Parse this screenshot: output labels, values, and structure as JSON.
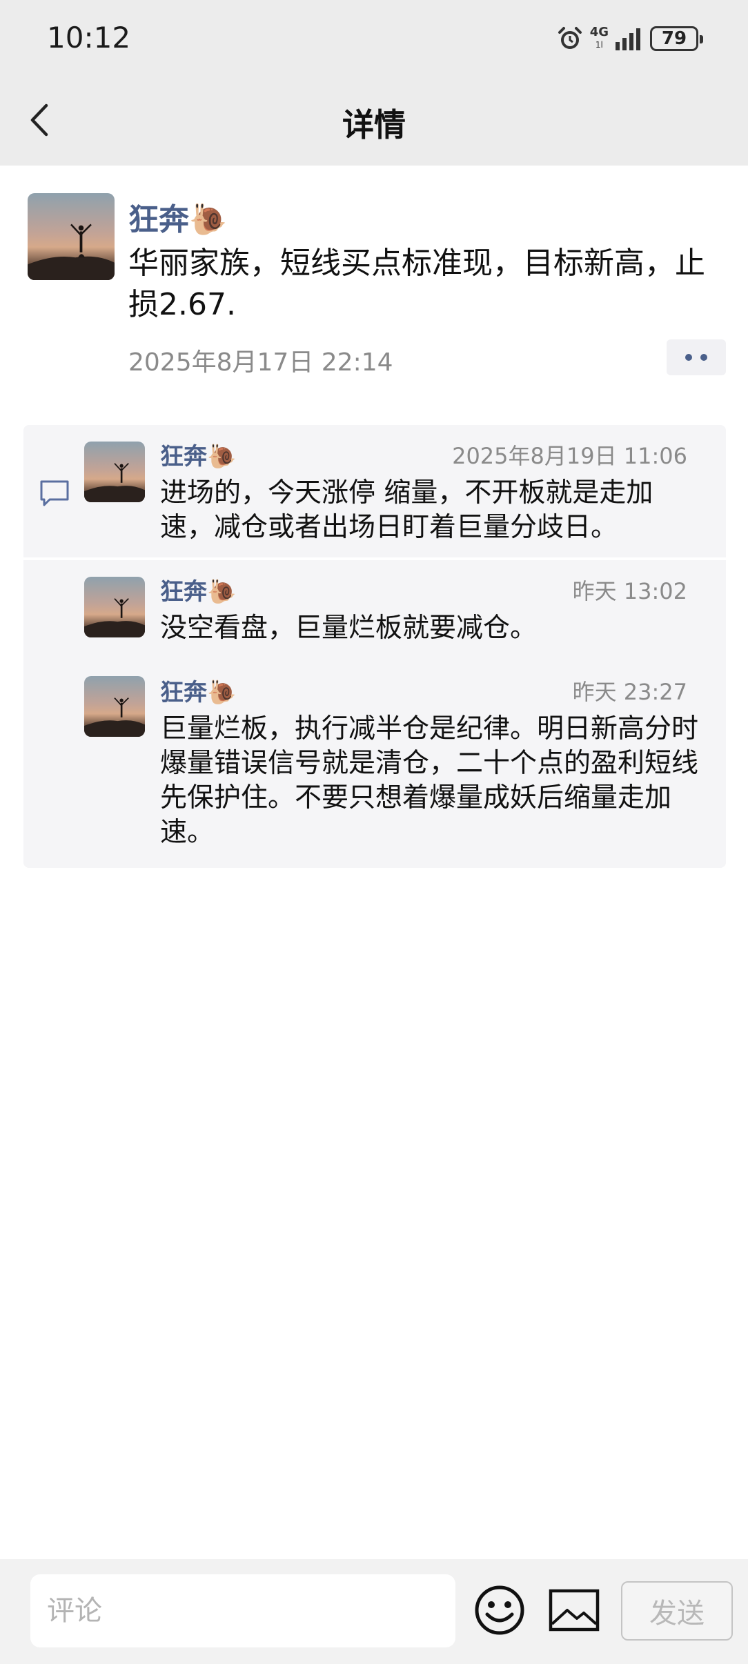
{
  "status_bar": {
    "time": "10:12",
    "network": "4G",
    "network_sub": "1l",
    "battery": "79"
  },
  "nav": {
    "title": "详情"
  },
  "post": {
    "author": "狂奔🐌",
    "text": "华丽家族，短线买点标准现，目标新高，止损2.67.",
    "time": "2025年8月17日 22:14"
  },
  "comments": [
    {
      "author": "狂奔🐌",
      "time": "2025年8月19日 11:06",
      "text": "进场的，今天涨停 缩量，不开板就是走加速，减仓或者出场日盯着巨量分歧日。"
    },
    {
      "author": "狂奔🐌",
      "time": "昨天 13:02",
      "text": "没空看盘，巨量烂板就要减仓。"
    },
    {
      "author": "狂奔🐌",
      "time": "昨天 23:27",
      "text": "巨量烂板，执行减半仓是纪律。明日新高分时爆量错误信号就是清仓，二十个点的盈利短线先保护住。不要只想着爆量成妖后缩量走加速。"
    }
  ],
  "composer": {
    "placeholder": "评论",
    "send_label": "发送"
  },
  "icons": {
    "back": "back-arrow-icon",
    "comment": "comment-bubble-icon",
    "emoji": "emoji-icon",
    "image": "image-icon",
    "alarm": "alarm-icon",
    "signal": "signal-icon",
    "battery": "battery-icon"
  }
}
